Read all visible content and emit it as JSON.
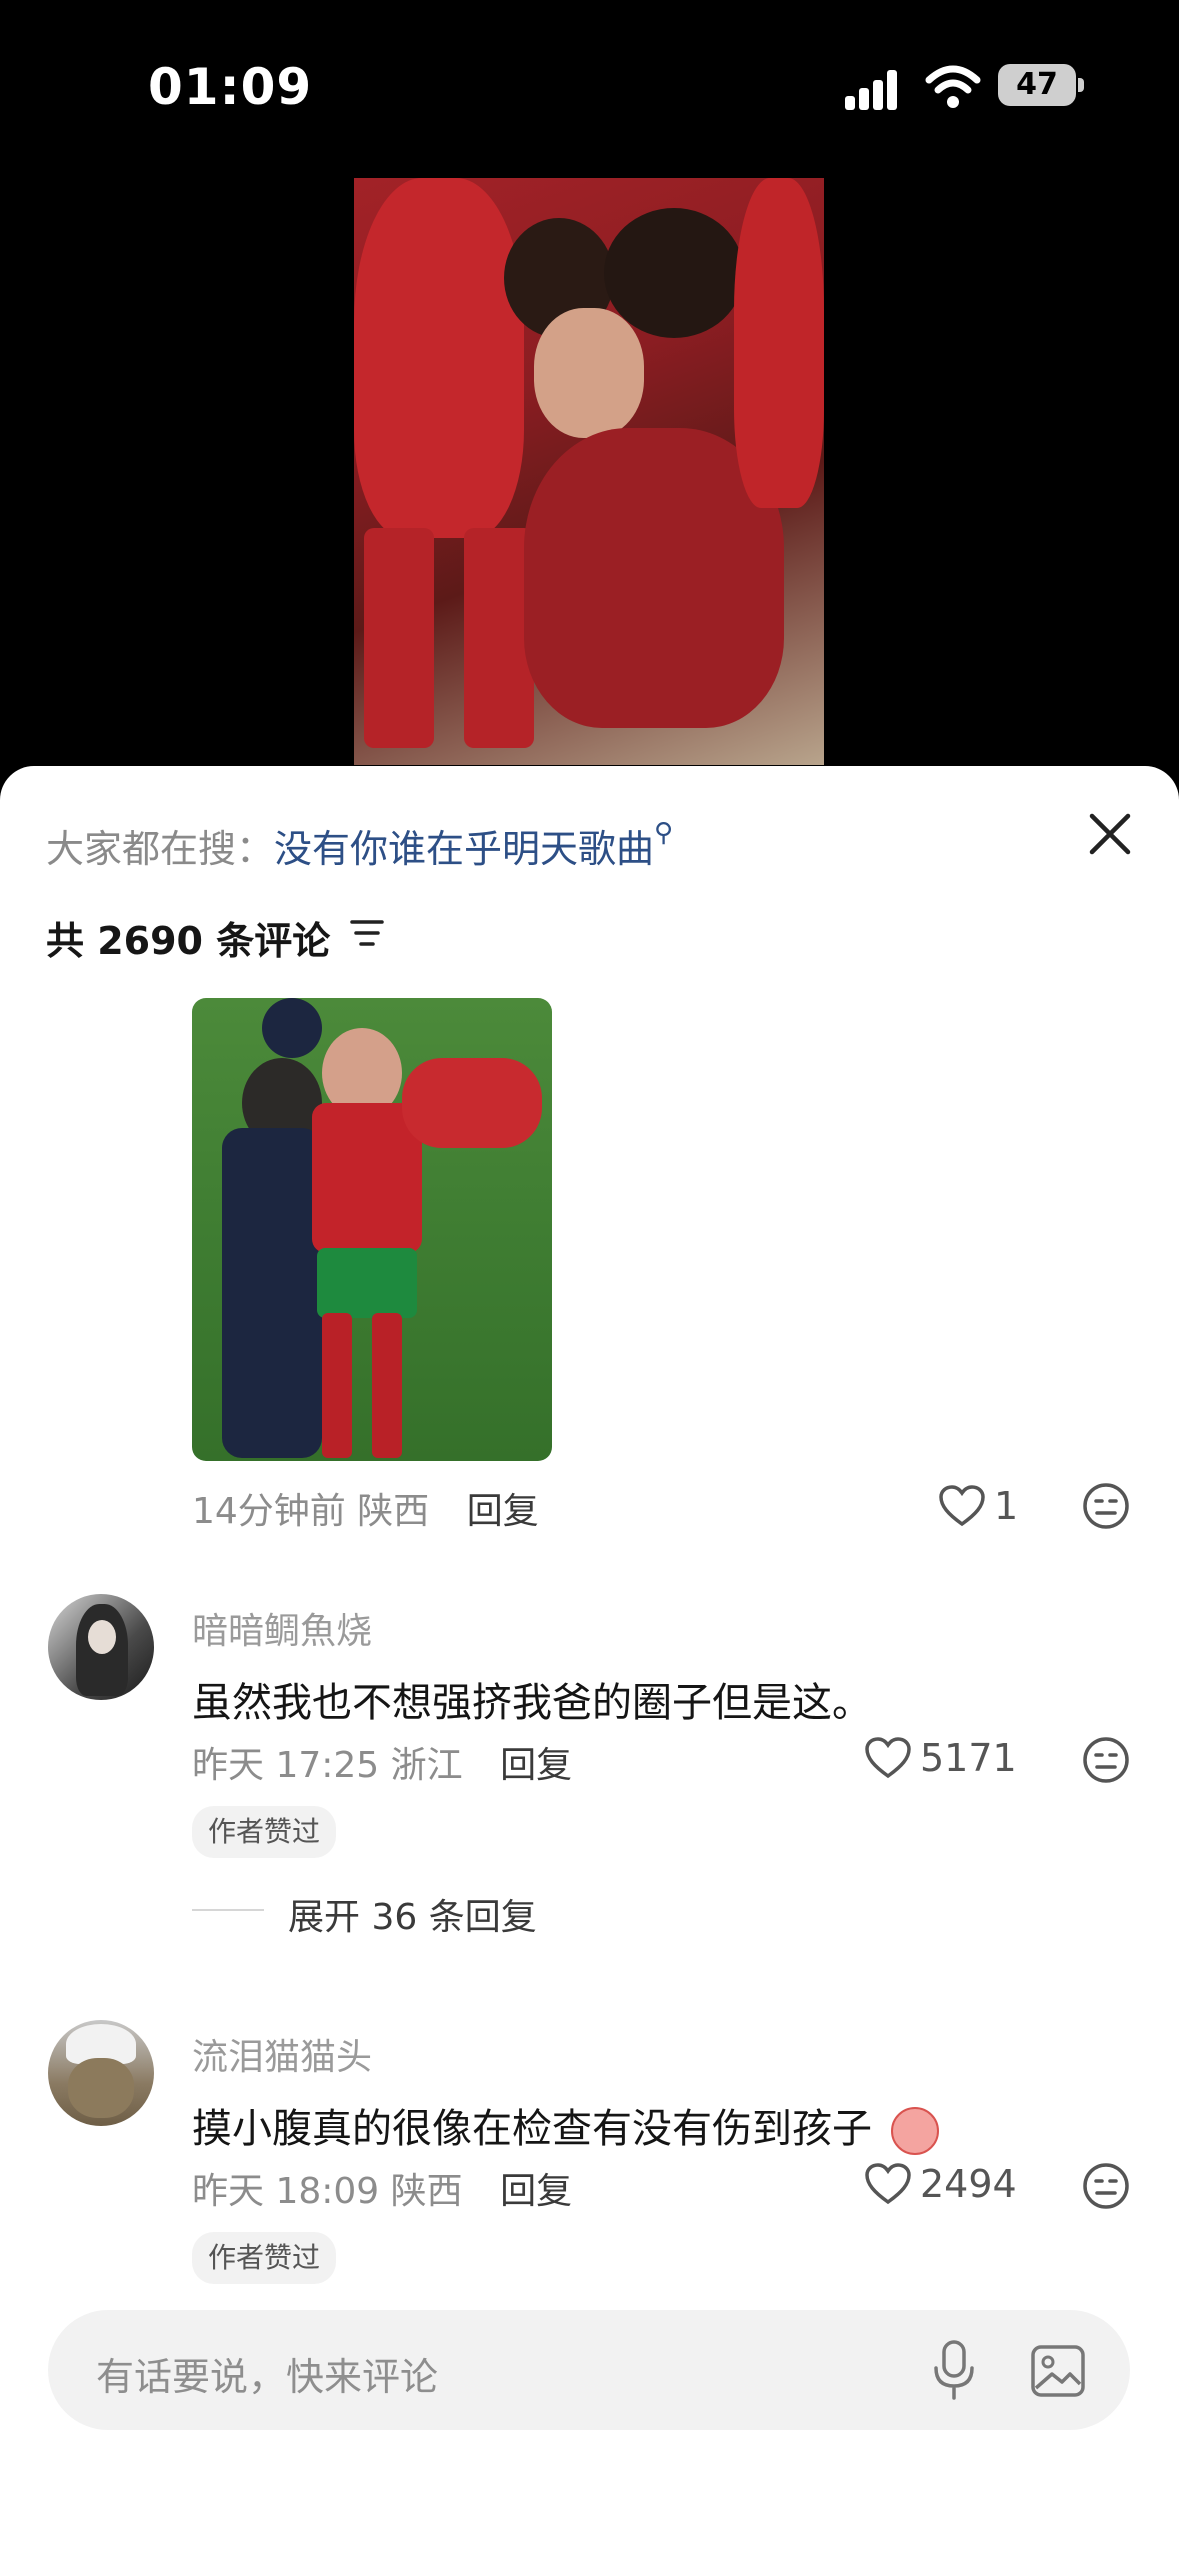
{
  "status_bar": {
    "time": "01:09",
    "battery": "47"
  },
  "search_hint": {
    "prefix": "大家都在搜：",
    "query": "没有你谁在乎明天歌曲"
  },
  "comments_header": {
    "count_label": "共 2690 条评论"
  },
  "comments": [
    {
      "time": "14分钟前",
      "location": "陕西",
      "reply_label": "回复",
      "likes": "1"
    },
    {
      "username": "暗暗鲷魚烧",
      "text": "虽然我也不想强挤我爸的圈子但是这。",
      "time": "昨天 17:25",
      "location": "浙江",
      "reply_label": "回复",
      "likes": "5171",
      "badge": "作者赞过",
      "expand_label": "展开 36 条回复"
    },
    {
      "username": "流泪猫猫头",
      "text": "摸小腹真的很像在检查有没有伤到孩子",
      "time": "昨天 18:09",
      "location": "陕西",
      "reply_label": "回复",
      "likes": "2494",
      "badge": "作者赞过"
    }
  ],
  "input": {
    "placeholder": "有话要说，快来评论"
  },
  "icons": [
    "signal-icon",
    "wifi-icon",
    "battery-icon",
    "close-icon",
    "filter-icon",
    "heart-icon",
    "face-icon",
    "mic-icon",
    "image-icon"
  ],
  "colors": {
    "link": "#2d4f86",
    "background_top": "#000000",
    "sheet": "#ffffff"
  }
}
